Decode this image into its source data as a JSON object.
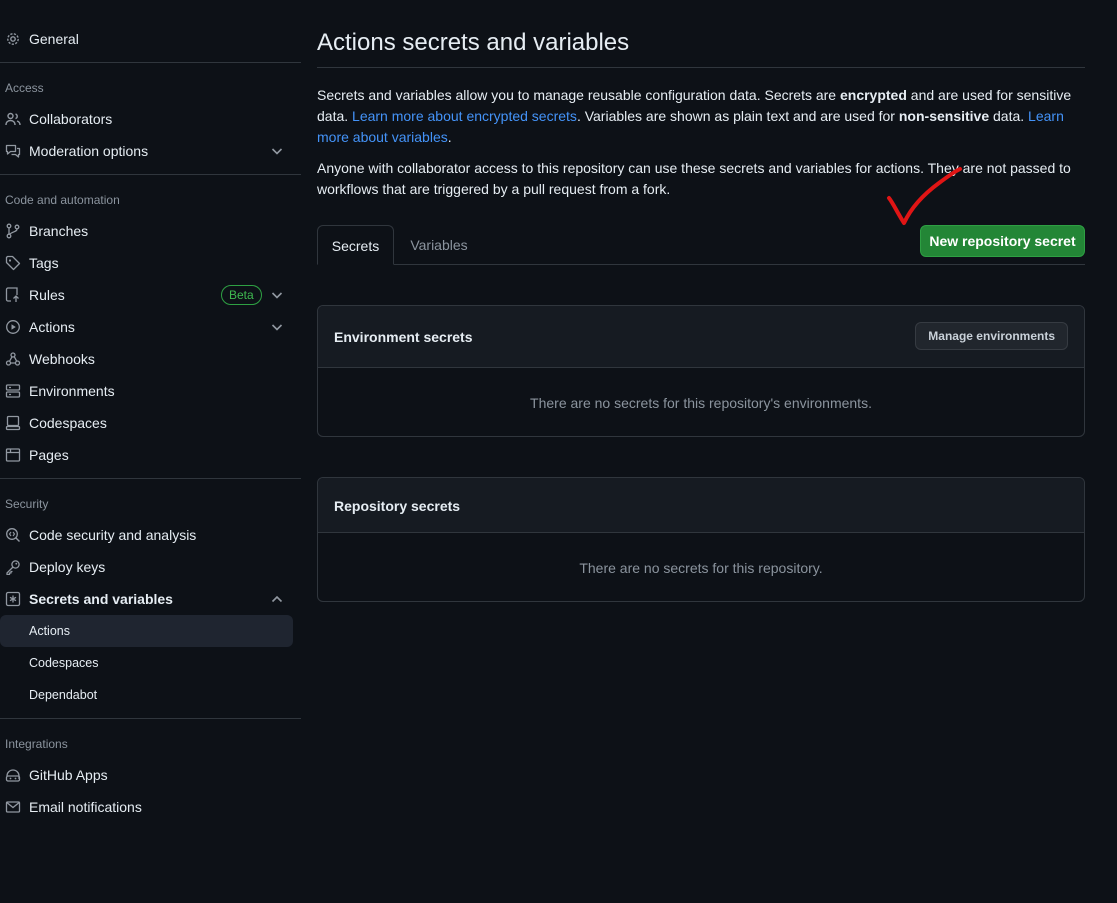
{
  "sidebar": {
    "general": "General",
    "sections": {
      "access": "Access",
      "code_automation": "Code and automation",
      "security": "Security",
      "integrations": "Integrations"
    },
    "items": {
      "collaborators": "Collaborators",
      "moderation": "Moderation options",
      "branches": "Branches",
      "tags": "Tags",
      "rules": "Rules",
      "rules_badge": "Beta",
      "actions": "Actions",
      "webhooks": "Webhooks",
      "environments": "Environments",
      "codespaces": "Codespaces",
      "pages": "Pages",
      "code_security": "Code security and analysis",
      "deploy_keys": "Deploy keys",
      "secrets_variables": "Secrets and variables",
      "sub_actions": "Actions",
      "sub_codespaces": "Codespaces",
      "sub_dependabot": "Dependabot",
      "github_apps": "GitHub Apps",
      "email_notifications": "Email notifications"
    }
  },
  "main": {
    "title": "Actions secrets and variables",
    "intro": {
      "t1": "Secrets and variables allow you to manage reusable configuration data. Secrets are ",
      "b1": "encrypted",
      "t2": " and are used for sensitive data. ",
      "link1": "Learn more about encrypted secrets",
      "t3": ". Variables are shown as plain text and are used for ",
      "b2": "non-sensitive",
      "t4": " data. ",
      "link2": "Learn more about variables",
      "t5": "."
    },
    "access_note": "Anyone with collaborator access to this repository can use these secrets and variables for actions. They are not passed to workflows that are triggered by a pull request from a fork.",
    "tabs": [
      "Secrets",
      "Variables"
    ],
    "new_secret_button": "New repository secret",
    "environment_secrets": {
      "title": "Environment secrets",
      "manage_button": "Manage environments",
      "empty": "There are no secrets for this repository's environments."
    },
    "repository_secrets": {
      "title": "Repository secrets",
      "empty": "There are no secrets for this repository."
    }
  },
  "colors": {
    "background": "#0d1117",
    "primary_button": "#238636",
    "link": "#4493f8",
    "annotation": "#e01515"
  },
  "icons": {
    "general": "gear-icon",
    "collaborators": "people-icon",
    "moderation": "comment-discussion-icon",
    "branches": "git-branch-icon",
    "tags": "tag-icon",
    "rules": "repo-push-icon",
    "actions": "play-icon",
    "webhooks": "webhook-icon",
    "environments": "server-icon",
    "codespaces": "codespaces-icon",
    "pages": "browser-icon",
    "code_security": "codescan-icon",
    "deploy_keys": "key-icon",
    "secrets_variables": "key-asterisk-icon",
    "github_apps": "apps-icon",
    "email_notifications": "mail-icon"
  }
}
